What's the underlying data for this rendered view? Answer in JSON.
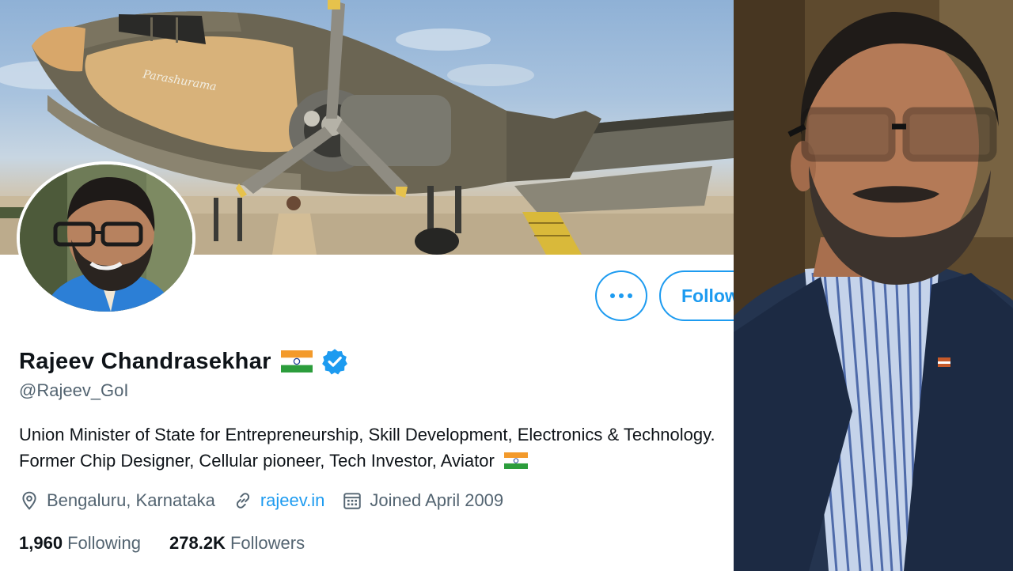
{
  "profile": {
    "display_name": "Rajeev Chandrasekhar",
    "handle": "@Rajeev_GoI",
    "bio": "Union Minister of State for Entrepreneurship, Skill Development, Electronics & Technology. Former Chip Designer, Cellular pioneer, Tech Investor, Aviator",
    "location": "Bengaluru, Karnataka",
    "website": "rajeev.in",
    "joined": "Joined April 2009",
    "following_count": "1,960",
    "following_label": "Following",
    "followers_count": "278.2K",
    "followers_label": "Followers",
    "aircraft_name": "Parashurama"
  },
  "actions": {
    "more_label": "More",
    "follow_label": "Follow"
  },
  "icons": {
    "more": "ellipsis-icon",
    "verified": "verified-badge-icon",
    "flag": "india-flag-icon",
    "location": "location-pin-icon",
    "link": "link-icon",
    "calendar": "calendar-icon"
  },
  "colors": {
    "accent": "#1d9bf0",
    "text_primary": "#0f1419",
    "text_secondary": "#536471"
  }
}
